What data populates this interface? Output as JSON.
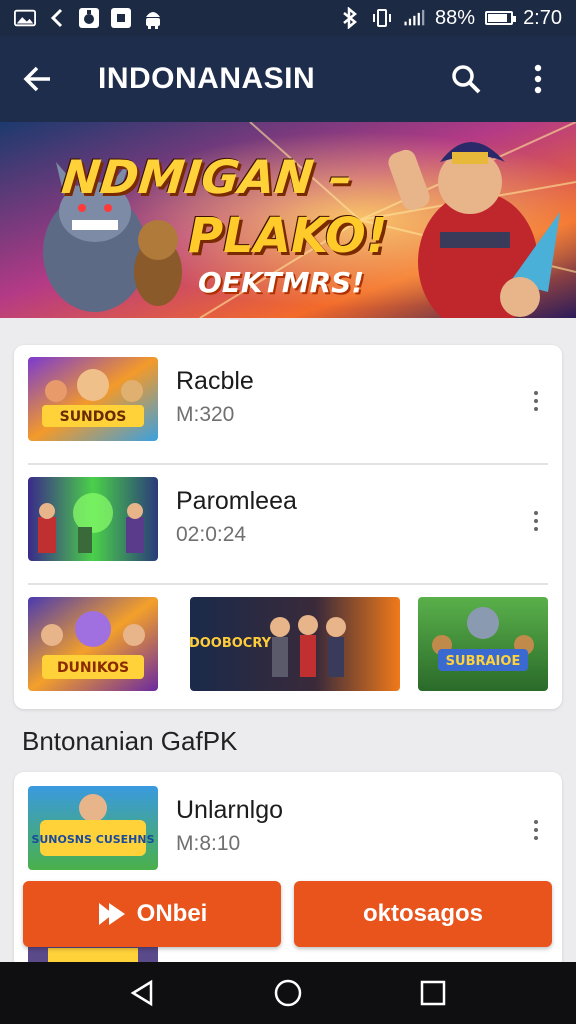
{
  "status_bar": {
    "battery_text": "88%",
    "battery_level": 0.88,
    "time": "2:70",
    "icons": [
      "image-icon",
      "back-chevron-icon",
      "app-icon",
      "app-icon-2",
      "android-icon",
      "bluetooth-icon",
      "vibrate-icon",
      "signal-icon",
      "battery-icon"
    ]
  },
  "app_bar": {
    "title": "INDONANASIN",
    "back_icon": "arrow-left-icon",
    "search_icon": "search-icon",
    "menu_icon": "more-vertical-icon"
  },
  "banner": {
    "line1": "NDMIGAN –",
    "line2": "PLAKO!",
    "line3": "OEKTMRS!"
  },
  "list": [
    {
      "title": "Racble",
      "subtitle": "M:320",
      "thumb_text": "SUNDOS"
    },
    {
      "title": "Paromleea",
      "subtitle": "02:0:24",
      "thumb_text": ""
    }
  ],
  "tiles": [
    {
      "label": "DUNIKOS"
    },
    {
      "label": "DOOBOCRY"
    },
    {
      "label": "SUBRAIOE"
    }
  ],
  "section": {
    "title": "Bntonanian GafPK"
  },
  "list2": [
    {
      "title": "Unlarnlgo",
      "subtitle": "M:8:10",
      "thumb_text": "SUNOSNS CUSEHNS"
    }
  ],
  "buttons": {
    "primary_label": "ONbei",
    "primary_icon": "play-arrow-icon",
    "secondary_label": "oktosagos"
  },
  "colors": {
    "app_bar": "#1f2d4d",
    "status_bar": "#1c2a44",
    "accent": "#e8541c",
    "nav_bar": "#0f0f12"
  }
}
